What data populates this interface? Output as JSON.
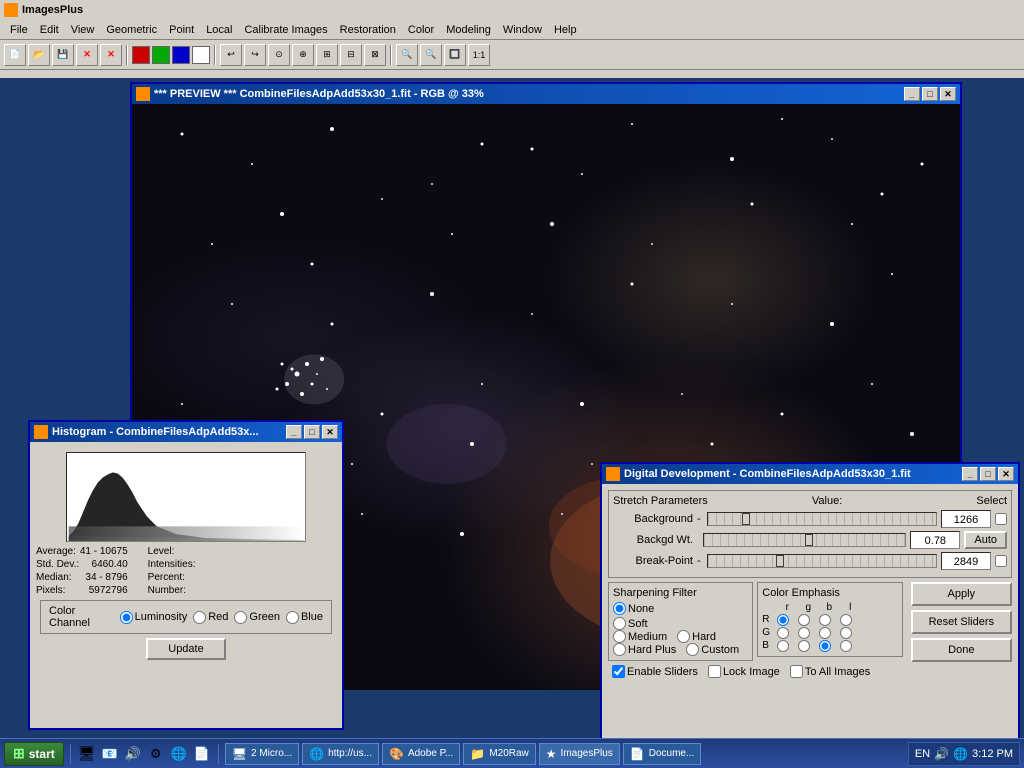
{
  "app": {
    "title": "ImagesPlus",
    "title_icon": "★"
  },
  "menu": {
    "items": [
      "File",
      "Edit",
      "View",
      "Geometric",
      "Point",
      "Local",
      "Calibrate Images",
      "Restoration",
      "Color",
      "Modeling",
      "Window",
      "Help"
    ]
  },
  "preview_window": {
    "title": "*** PREVIEW *** CombineFilesAdpAdd53x30_1.fit - RGB @ 33%",
    "min_label": "_",
    "max_label": "□",
    "close_label": "✕"
  },
  "histogram_window": {
    "title": "Histogram - CombineFilesAdpAdd53x...",
    "stats": {
      "average_label": "Average:",
      "average_value": "41 - 10675",
      "stddev_label": "Std. Dev.:",
      "stddev_value": "6460.40",
      "median_label": "Median:",
      "median_value": "34 - 8796",
      "pixels_label": "Pixels:",
      "pixels_value": "5972796",
      "level_label": "Level:",
      "level_value": "",
      "intensities_label": "Intensities:",
      "intensities_value": "",
      "percent_label": "Percent:",
      "percent_value": "",
      "number_label": "Number:",
      "number_value": ""
    },
    "color_channel_label": "Color Channel",
    "channels": [
      "Luminosity",
      "Red",
      "Green",
      "Blue"
    ],
    "selected_channel": "Luminosity",
    "update_button": "Update"
  },
  "dd_window": {
    "title": "Digital Development - CombineFilesAdpAdd53x30_1.fit",
    "stretch_section": "Stretch Parameters",
    "value_label": "Value:",
    "select_label": "Select",
    "background_label": "Background",
    "background_value": "1266",
    "backgd_wt_label": "Backgd Wt.",
    "backgd_wt_value": "0.78",
    "auto_label": "Auto",
    "break_point_label": "Break-Point",
    "break_point_value": "2849",
    "sharpening_label": "Sharpening Filter",
    "sharp_options": [
      "None",
      "Soft",
      "Medium",
      "Hard",
      "Hard Plus",
      "Custom"
    ],
    "selected_sharp": "None",
    "color_emphasis_label": "Color Emphasis",
    "ce_headers": [
      "r",
      "g",
      "b",
      "l"
    ],
    "ce_rows": [
      {
        "label": "R",
        "r": true,
        "g": false,
        "b": false,
        "l": false
      },
      {
        "label": "G",
        "r": false,
        "g": false,
        "b": false,
        "l": false
      },
      {
        "label": "B",
        "r": false,
        "g": false,
        "b": true,
        "l": false
      }
    ],
    "apply_label": "Apply",
    "reset_sliders_label": "Reset Sliders",
    "done_label": "Done",
    "enable_sliders_label": "Enable Sliders",
    "lock_image_label": "Lock Image",
    "to_all_images_label": "To All Images",
    "enable_sliders_checked": true,
    "lock_image_checked": false,
    "to_all_images_checked": false
  },
  "taskbar": {
    "start_label": "start",
    "time": "3:12 PM",
    "lang": "EN",
    "tasks": [
      "2 Micro...",
      "http://us...",
      "Adobe P...",
      "M20Raw",
      "ImagesPlus",
      "Docume..."
    ]
  }
}
